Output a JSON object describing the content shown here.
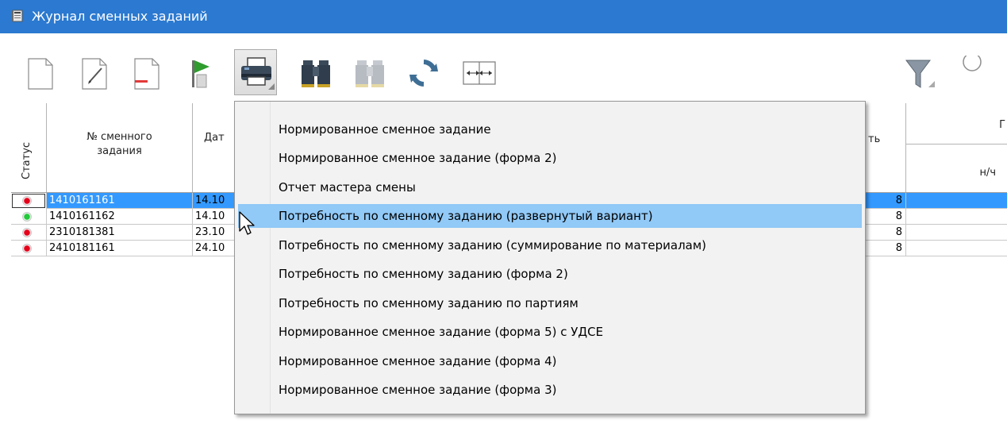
{
  "window": {
    "title": "Журнал сменных заданий",
    "accent_color": "#2b79d0"
  },
  "toolbar": {
    "buttons": [
      {
        "icon": "new-document-icon"
      },
      {
        "icon": "edit-document-icon"
      },
      {
        "icon": "delete-document-icon"
      },
      {
        "icon": "flag-icon"
      },
      {
        "icon": "printer-icon",
        "pressed": true
      },
      {
        "icon": "binoculars-icon"
      },
      {
        "icon": "binoculars-disabled-icon"
      },
      {
        "icon": "refresh-icon"
      },
      {
        "icon": "column-width-icon"
      },
      {
        "icon": "filter-icon"
      },
      {
        "icon": "radio-icon"
      }
    ]
  },
  "grid": {
    "columns": {
      "status": "Статус",
      "number": "№ сменного задания",
      "number_line1": "№ сменного",
      "number_line2": "задания",
      "date_partial": "Дат",
      "right_partial": "ть",
      "right_top_partial": "Г",
      "right_sub": "н/ч"
    },
    "rows": [
      {
        "status": "red",
        "number": "1410161161",
        "date": "14.10",
        "value": "8",
        "selected": true
      },
      {
        "status": "green",
        "number": "1410161162",
        "date": "14.10",
        "value": "8",
        "selected": false
      },
      {
        "status": "red",
        "number": "2310181381",
        "date": "23.10",
        "value": "8",
        "selected": false
      },
      {
        "status": "red",
        "number": "2410181161",
        "date": "24.10",
        "value": "8",
        "selected": false
      }
    ]
  },
  "print_menu": {
    "items": [
      {
        "label": "Нормированное сменное задание"
      },
      {
        "label": "Нормированное сменное задание (форма 2)"
      },
      {
        "label": "Отчет мастера смены"
      },
      {
        "label": "Потребность по сменному заданию (развернутый вариант)",
        "highlighted": true
      },
      {
        "label": "Потребность по сменному заданию (суммирование по материалам)"
      },
      {
        "label": "Потребность по сменному заданию (форма 2)"
      },
      {
        "label": "Потребность по сменному заданию по партиям"
      },
      {
        "label": "Нормированное сменное задание (форма 5) с УДСЕ"
      },
      {
        "label": "Нормированное сменное задание (форма 4)"
      },
      {
        "label": "Нормированное сменное задание (форма 3)"
      }
    ],
    "highlight_color": "#91c9f7"
  }
}
